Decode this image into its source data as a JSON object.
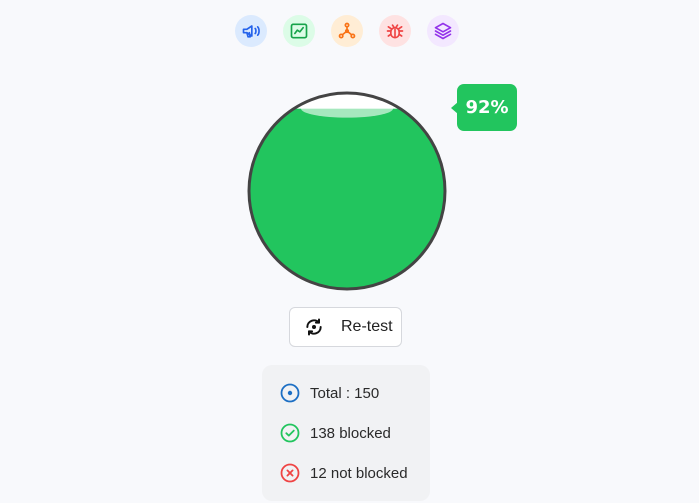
{
  "toolbar": {
    "icons": [
      {
        "name": "megaphone-icon",
        "bg": "#dbeafe",
        "color": "#2563eb"
      },
      {
        "name": "chart-line-icon",
        "bg": "#dcfce7",
        "color": "#16a34a"
      },
      {
        "name": "network-icon",
        "bg": "#ffedd5",
        "color": "#f97316"
      },
      {
        "name": "bug-icon",
        "bg": "#fee2e2",
        "color": "#ef4444"
      },
      {
        "name": "layers-icon",
        "bg": "#f3e8ff",
        "color": "#9333ea"
      }
    ]
  },
  "gauge": {
    "percent": 92,
    "label": "92%",
    "fill_color": "#22c55e",
    "border_color": "#444444"
  },
  "retest": {
    "label": "Re-test",
    "icon": "refresh-icon"
  },
  "stats": {
    "total_label": "Total : 150",
    "blocked_label": "138 blocked",
    "not_blocked_label": "12 not blocked",
    "total_color": "#1d6fc4",
    "blocked_color": "#22c55e",
    "not_blocked_color": "#ef4444"
  }
}
